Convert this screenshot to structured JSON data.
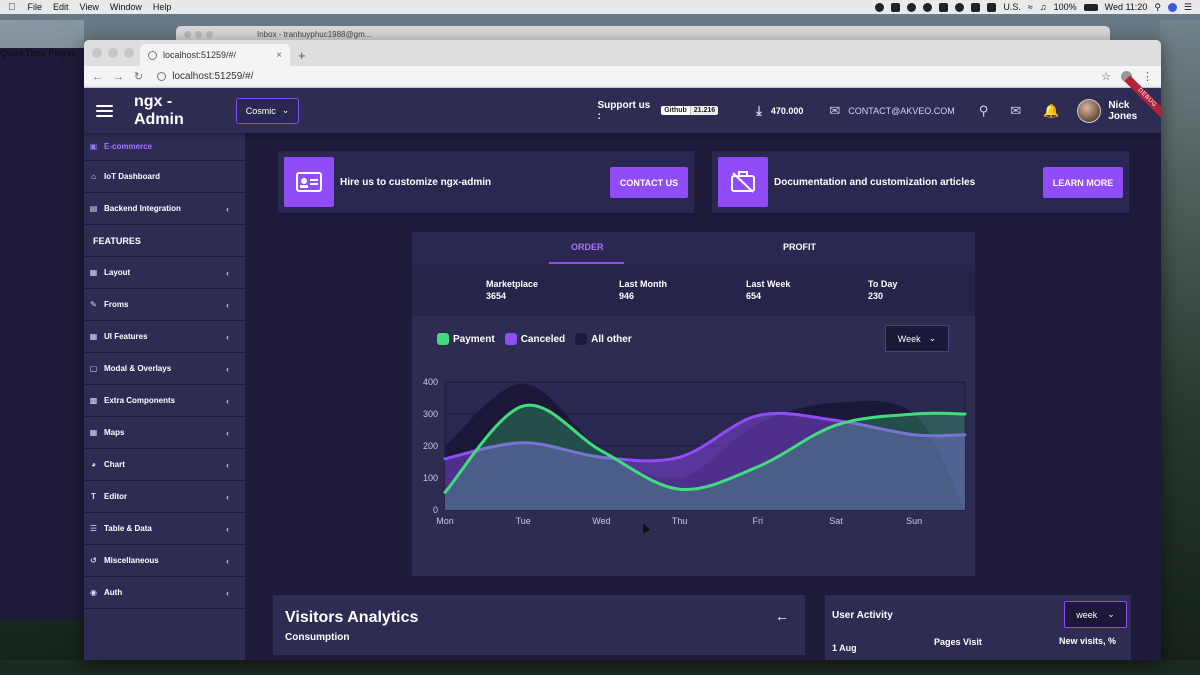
{
  "menubar": {
    "app": "QuickTime Player",
    "items": [
      "File",
      "Edit",
      "View",
      "Window",
      "Help"
    ],
    "locale": "U.S.",
    "battery": "100%",
    "clock": "Wed 11:20"
  },
  "bg_window": {
    "tab_text": "Inbox - tranhuyphuc1988@gm..."
  },
  "browser": {
    "tab_title": "localhost:51259/#/",
    "url": "localhost:51259/#/"
  },
  "header": {
    "brand": "ngx - Admin",
    "theme": "Cosmic",
    "support_label": "Support us :",
    "github_label": "Github",
    "github_count": "21.216",
    "downloads": "470.000",
    "contact": "CONTACT@AKVEO.COM",
    "user_name": "Nick Jones",
    "ribbon": "DEBUG"
  },
  "sidebar": {
    "active_item": "E-commerce",
    "top_items": [
      "IoT Dashboard",
      "Backend Integration"
    ],
    "section": "FEATURES",
    "items": [
      "Layout",
      "Froms",
      "UI Features",
      "Modal & Overlays",
      "Extra Components",
      "Maps",
      "Chart",
      "Editor",
      "Table & Data",
      "Miscellaneous",
      "Auth"
    ]
  },
  "promos": [
    {
      "text": "Hire us to customize ngx-admin",
      "button": "CONTACT US"
    },
    {
      "text": "Documentation and customization articles",
      "button": "LEARN MORE"
    }
  ],
  "orders_card": {
    "tabs": [
      "ORDER",
      "PROFIT"
    ],
    "summary": [
      {
        "label": "Marketplace",
        "value": "3654"
      },
      {
        "label": "Last Month",
        "value": "946"
      },
      {
        "label": "Last Week",
        "value": "654"
      },
      {
        "label": "To Day",
        "value": "230"
      }
    ],
    "period": "Week"
  },
  "chart_data": {
    "type": "area",
    "categories": [
      "Mon",
      "Tue",
      "Wed",
      "Thu",
      "Fri",
      "Sat",
      "Sun"
    ],
    "ylim": [
      0,
      400
    ],
    "yticks": [
      0,
      100,
      200,
      300,
      400
    ],
    "grid": true,
    "legend": "top-left",
    "series": [
      {
        "name": "All other",
        "color": "#1c1a3a",
        "values": [
          200,
          395,
          190,
          100,
          270,
          335,
          300,
          0
        ]
      },
      {
        "name": "Canceled",
        "color": "#8f4cf7",
        "values": [
          160,
          210,
          165,
          165,
          295,
          280,
          235,
          235
        ]
      },
      {
        "name": "Payment",
        "color": "#40dc7e",
        "values": [
          55,
          325,
          185,
          65,
          135,
          265,
          300,
          300
        ]
      }
    ]
  },
  "visitors": {
    "title": "Visitors Analytics",
    "subtitle": "Consumption"
  },
  "activity": {
    "title": "User Activity",
    "period": "week",
    "col_pages": "Pages Visit",
    "col_new": "New visits, %",
    "first_row": "1 Aug"
  }
}
